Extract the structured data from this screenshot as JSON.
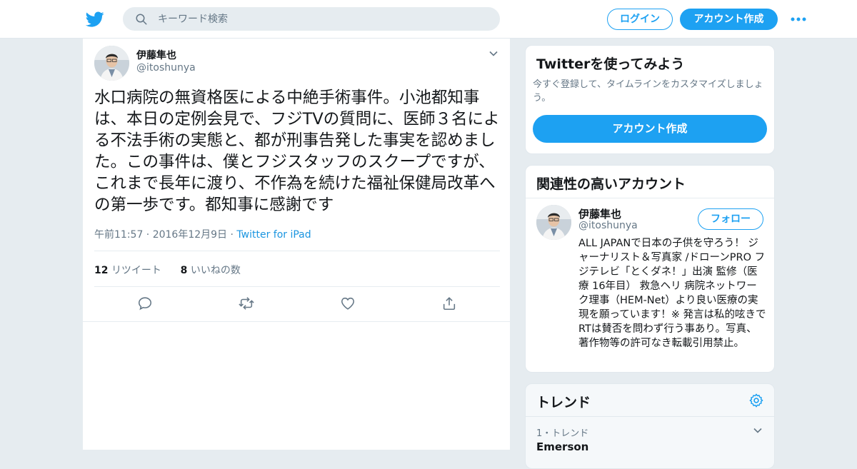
{
  "header": {
    "search_placeholder": "キーワード検索",
    "login_label": "ログイン",
    "signup_label": "アカウント作成"
  },
  "tweet": {
    "author_name": "伊藤隼也",
    "author_handle": "@itoshunya",
    "text": "水口病院の無資格医による中絶手術事件。小池都知事は、本日の定例会見で、フジTVの質問に、医師３名による不法手術の実態と、都が刑事告発した事実を認めました。この事件は、僕とフジスタッフのスクープですが、これまで長年に渡り、不作為を続けた福祉保健局改革への第一歩です。都知事に感謝です",
    "timestamp": "午前11:57 · 2016年12月9日",
    "separator": "·",
    "client": "Twitter for iPad",
    "retweet_count": "12",
    "retweet_label": "リツイート",
    "like_count": "8",
    "like_label": "いいねの数"
  },
  "signup_card": {
    "title": "Twitterを使ってみよう",
    "description": "今すぐ登録して、タイムラインをカスタマイズしましょう。",
    "button_label": "アカウント作成"
  },
  "related_card": {
    "title": "関連性の高いアカウント",
    "account": {
      "name": "伊藤隼也",
      "handle": "@itoshunya",
      "follow_label": "フォロー",
      "bio": "ALL JAPANで日本の子供を守ろう！ ジャーナリスト＆写真家 /ドローンPRO フジテレビ「とくダネ！」出演 監修（医療 16年目） 救急ヘリ 病院ネットワーク理事（HEM-Net）より良い医療の実現を願っています！※ 発言は私的呟きでRTは賛否を問わず行う事あり。写真、著作物等の許可なき転載引用禁止。"
    }
  },
  "trends_card": {
    "title": "トレンド",
    "items": [
      {
        "rank_label": "1・トレンド",
        "name": "Emerson"
      }
    ]
  },
  "colors": {
    "accent": "#1da1f2",
    "link": "#1b95e0",
    "muted_text": "#657786",
    "background": "#e6ecf0"
  },
  "icons": {
    "logo": "twitter-bird-icon",
    "search": "search-icon",
    "more": "more-dots-icon",
    "caret": "chevron-down-icon",
    "reply": "reply-icon",
    "retweet": "retweet-icon",
    "like": "heart-icon",
    "share": "share-icon",
    "settings": "gear-icon"
  }
}
